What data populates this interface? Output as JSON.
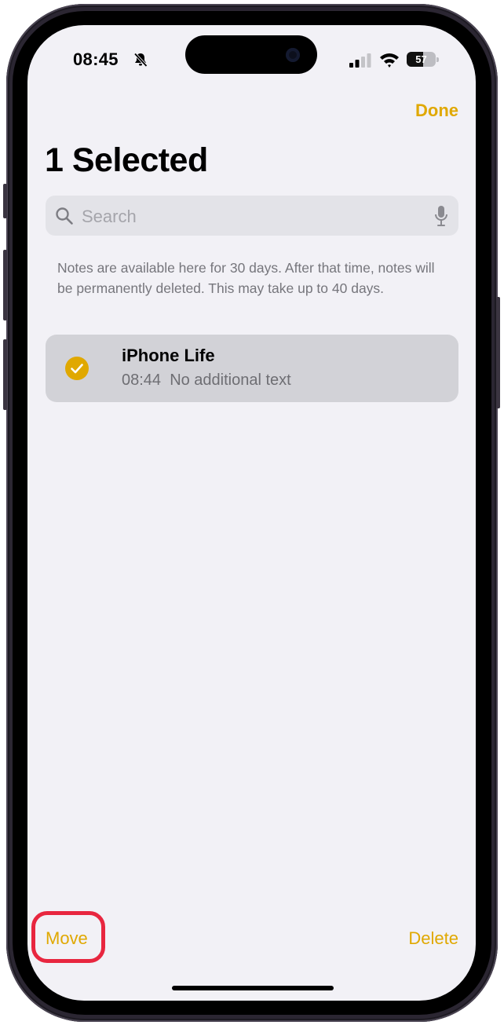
{
  "status_bar": {
    "time": "08:45",
    "battery_level": "57",
    "icons": [
      "bell-slash-icon",
      "cellular-signal-icon",
      "wifi-icon",
      "battery-icon"
    ]
  },
  "header": {
    "done_label": "Done",
    "title": "1 Selected"
  },
  "search": {
    "placeholder": "Search",
    "value": "",
    "icons": [
      "magnifier-icon",
      "microphone-icon"
    ]
  },
  "info_text": "Notes are available here for 30 days. After that time, notes will be permanently deleted. This may take up to 40 days.",
  "notes": [
    {
      "title": "iPhone Life",
      "time": "08:44",
      "preview": "No additional text",
      "selected": true
    }
  ],
  "toolbar": {
    "move_label": "Move",
    "delete_label": "Delete"
  },
  "colors": {
    "accent": "#e0a800",
    "highlight": "#e8263f",
    "background": "#f2f1f6",
    "row_selected": "#d2d2d7"
  }
}
